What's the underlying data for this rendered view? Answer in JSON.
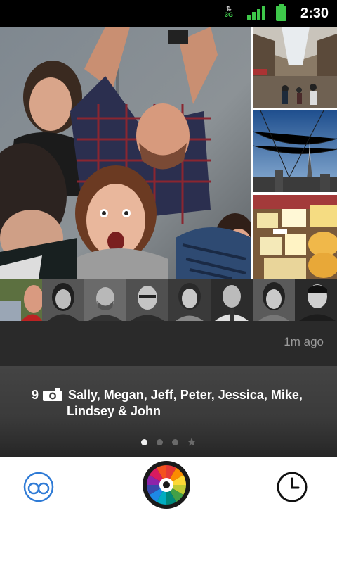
{
  "status_bar": {
    "network": "3G",
    "time": "2:30"
  },
  "album": {
    "time_ago": "1m ago",
    "photo_count": "9",
    "participants_line1": "Sally, Megan, Jeff, Peter, Jessica, Mike,",
    "participants_line2": "Lindsey & John"
  },
  "pager": {
    "pages": 4,
    "active_index": 0
  },
  "colors": {
    "accent_blue": "#2f7bd6",
    "status_green": "#3ec84a"
  },
  "icons": {
    "friends": "infinity-circles-icon",
    "camera": "color-wheel-camera-icon",
    "history": "clock-icon"
  }
}
